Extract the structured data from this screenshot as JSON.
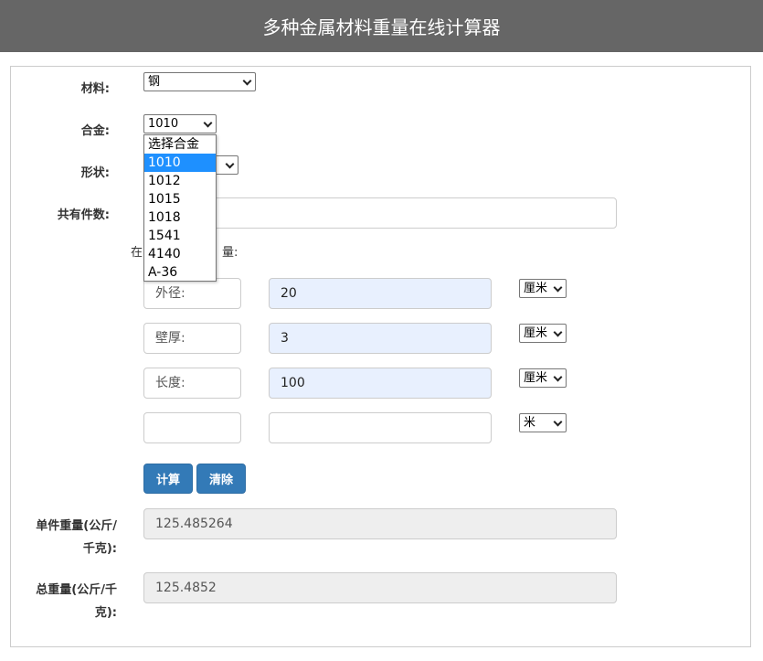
{
  "header": {
    "title": "多种金属材料重量在线计算器"
  },
  "form": {
    "material": {
      "label": "材料:",
      "value": "钢"
    },
    "alloy": {
      "label": "合金:",
      "value": "1010",
      "options": [
        "选择合金",
        "1010",
        "1012",
        "1015",
        "1018",
        "1541",
        "4140",
        "A-36"
      ],
      "selected_index": 1
    },
    "shape": {
      "label": "形状:"
    },
    "count": {
      "label": "共有件数:",
      "value": ""
    },
    "note_visible": {
      "prefix": "在",
      "suffix": "量:"
    },
    "dimensions": [
      {
        "name": "外径:",
        "value": "20",
        "unit": "厘米"
      },
      {
        "name": "壁厚:",
        "value": "3",
        "unit": "厘米"
      },
      {
        "name": "长度:",
        "value": "100",
        "unit": "厘米"
      },
      {
        "name": "",
        "value": "",
        "unit": "米"
      }
    ],
    "buttons": {
      "calculate": "计算",
      "clear": "清除"
    },
    "unit_weight": {
      "label_line1": "单件重量(公斤/",
      "label_line2": "千克):",
      "value": "125.485264"
    },
    "total_weight": {
      "label_line1": "总重量(公斤/千",
      "label_line2": "克):",
      "value": "125.4852"
    }
  },
  "colors": {
    "header_bg": "#666666",
    "button_bg": "#337ab7",
    "highlight": "#1e90ff"
  }
}
